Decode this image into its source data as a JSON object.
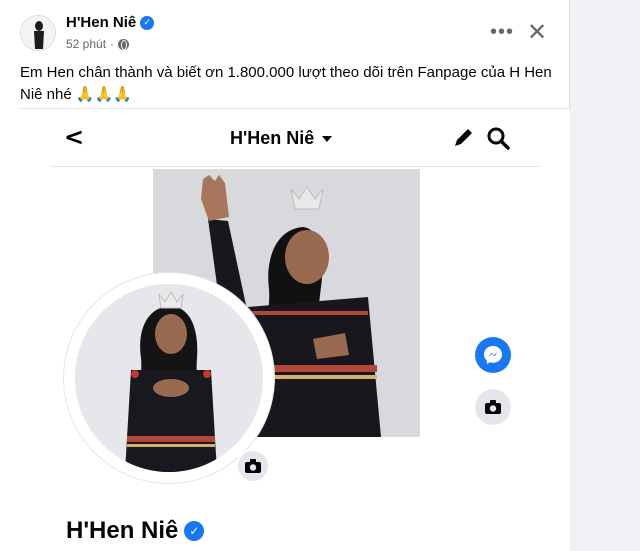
{
  "post": {
    "author": "H'Hen Niê",
    "time": "52 phút",
    "caption": "Em Hen chân thành và biết ơn 1.800.000 lượt theo dõi trên Fanpage của H Hen Niê nhé 🙏🙏🙏",
    "more_icon": "more-horizontal-icon",
    "close_icon": "close-icon"
  },
  "embedded": {
    "page_name": "H'Hen Niê",
    "profile_name": "H'Hen Niê"
  },
  "colors": {
    "accent": "#1877f2",
    "secondary_text": "#65676b"
  }
}
